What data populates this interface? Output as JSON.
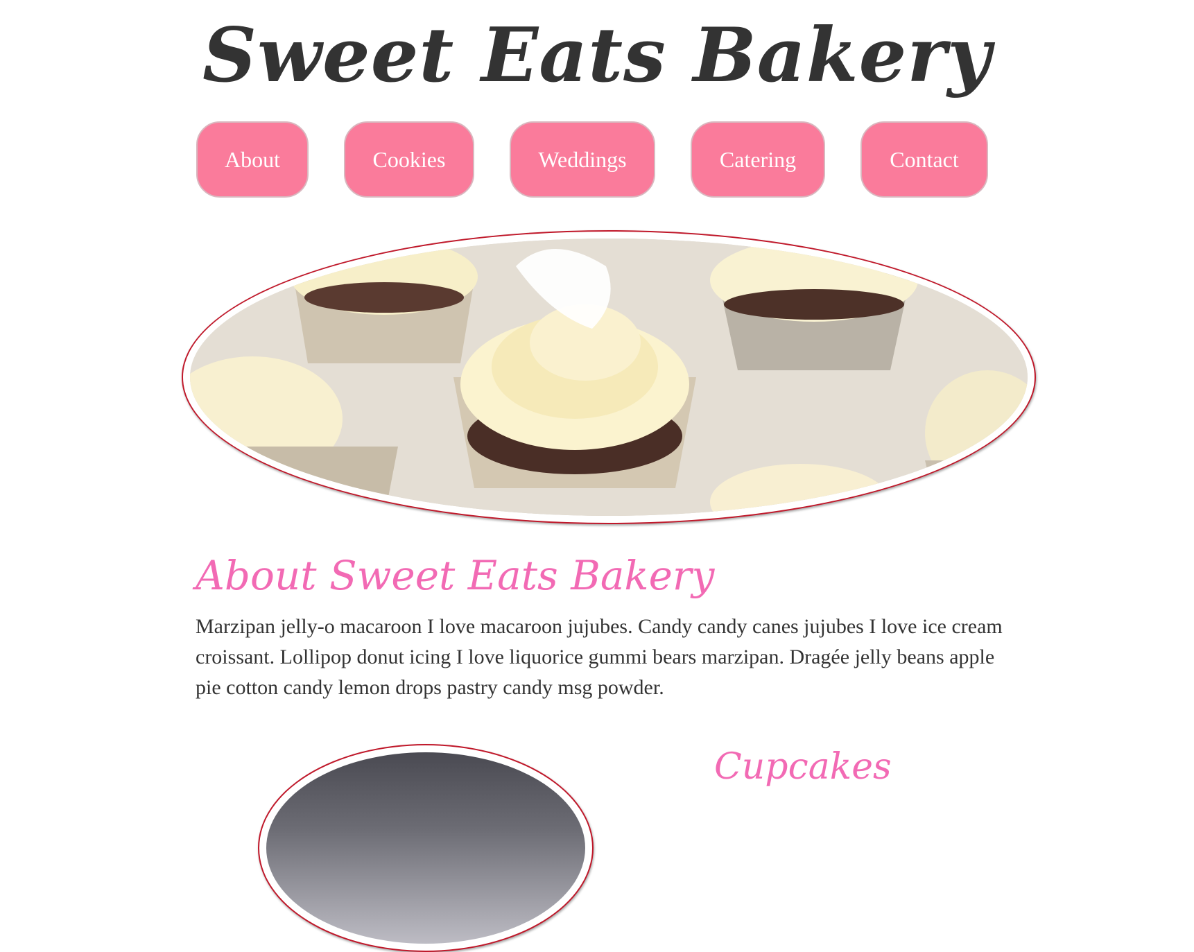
{
  "header": {
    "title": "Sweet Eats Bakery"
  },
  "nav": {
    "items": [
      {
        "label": "About"
      },
      {
        "label": "Cookies"
      },
      {
        "label": "Weddings"
      },
      {
        "label": "Catering"
      },
      {
        "label": "Contact"
      }
    ]
  },
  "hero": {
    "image": "cupcakes-photo"
  },
  "about": {
    "heading": "About Sweet Eats Bakery",
    "text": "Marzipan jelly-o macaroon I love macaroon jujubes. Candy candy canes jujubes I love ice cream croissant. Lollipop donut icing I love liquorice gummi bears marzipan. Dragée jelly beans apple pie cotton candy lemon drops pastry candy msg powder."
  },
  "cupcakes": {
    "heading": "Cupcakes",
    "image": "cupcake-photo"
  },
  "colors": {
    "nav_button": "#fa7b9b",
    "heading_pink": "#f26ab4",
    "frame_border": "#c0182a",
    "text": "#333333"
  }
}
